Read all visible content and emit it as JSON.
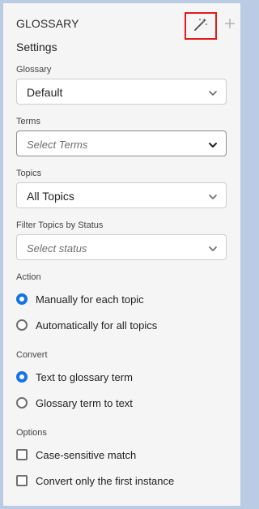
{
  "header": {
    "title": "GLOSSARY"
  },
  "icons": {
    "magic": "magic-wand-icon",
    "add": "plus-icon",
    "chevron": "chevron-down-icon"
  },
  "colors": {
    "accent": "#1473e6",
    "highlight_box": "#e01b1b",
    "panel_bg": "#f5f5f5",
    "frame_bg": "#b9cce4"
  },
  "settings": {
    "heading": "Settings"
  },
  "glossary": {
    "label": "Glossary",
    "value": "Default"
  },
  "terms": {
    "label": "Terms",
    "placeholder": "Select Terms"
  },
  "topics": {
    "label": "Topics",
    "value": "All Topics"
  },
  "filter": {
    "label": "Filter Topics by Status",
    "placeholder": "Select status"
  },
  "action": {
    "label": "Action",
    "options": [
      {
        "label": "Manually for each topic",
        "selected": true
      },
      {
        "label": "Automatically for all topics",
        "selected": false
      }
    ]
  },
  "convert": {
    "label": "Convert",
    "options": [
      {
        "label": "Text to glossary term",
        "selected": true
      },
      {
        "label": "Glossary term to text",
        "selected": false
      }
    ]
  },
  "options": {
    "label": "Options",
    "items": [
      {
        "label": "Case-sensitive match",
        "checked": false
      },
      {
        "label": "Convert only the first instance",
        "checked": false
      }
    ]
  }
}
